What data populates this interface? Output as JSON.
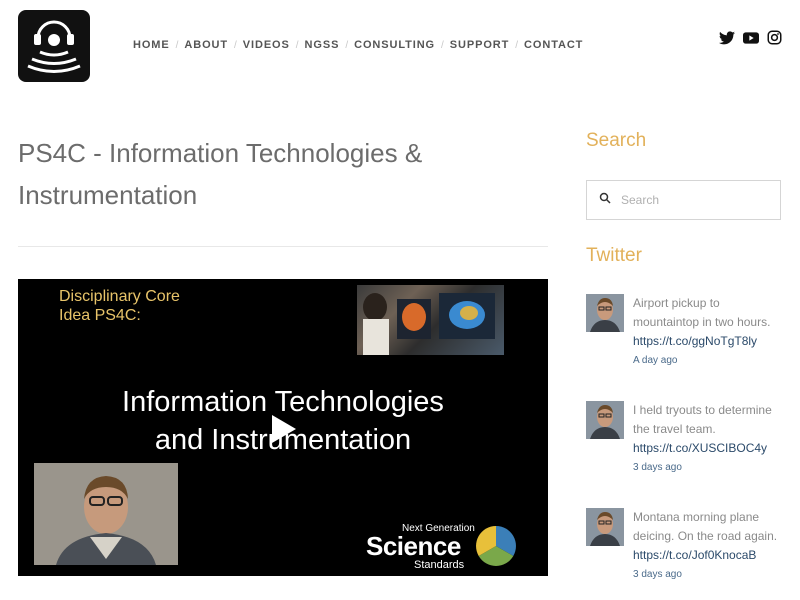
{
  "nav": {
    "items": [
      "HOME",
      "ABOUT",
      "VIDEOS",
      "NGSS",
      "CONSULTING",
      "SUPPORT",
      "CONTACT"
    ],
    "separator": "/"
  },
  "social": {
    "icons": [
      "twitter-icon",
      "youtube-icon",
      "instagram-icon"
    ]
  },
  "page": {
    "title": "PS4C - Information Technologies & Instrumentation"
  },
  "video": {
    "subtitle_line1": "Disciplinary Core",
    "subtitle_line2": "Idea PS4C:",
    "title_line1": "Information Technologies",
    "title_line2": "and Instrumentation",
    "logo_top": "Next Generation",
    "logo_main": "Science",
    "logo_bottom": "Standards",
    "logo_colors": [
      "#3b7fb8",
      "#e8c03a",
      "#7aa84a"
    ]
  },
  "sidebar": {
    "search_title": "Search",
    "search_placeholder": "Search",
    "twitter_title": "Twitter",
    "tweets": [
      {
        "text": "Airport pickup to mountaintop in two hours.",
        "link": "https://t.co/ggNoTgT8ly",
        "time": "A day ago"
      },
      {
        "text": "I held tryouts to determine the travel team.",
        "link": "https://t.co/XUSCIBOC4y",
        "time": "3 days ago"
      },
      {
        "text": "Montana morning plane deicing. On the road again.",
        "link": "https://t.co/Jof0KnocaB",
        "time": "3 days ago"
      }
    ]
  },
  "colors": {
    "accent": "#e2b15a",
    "nav_text": "#555555",
    "title_text": "#6c6c6c"
  }
}
